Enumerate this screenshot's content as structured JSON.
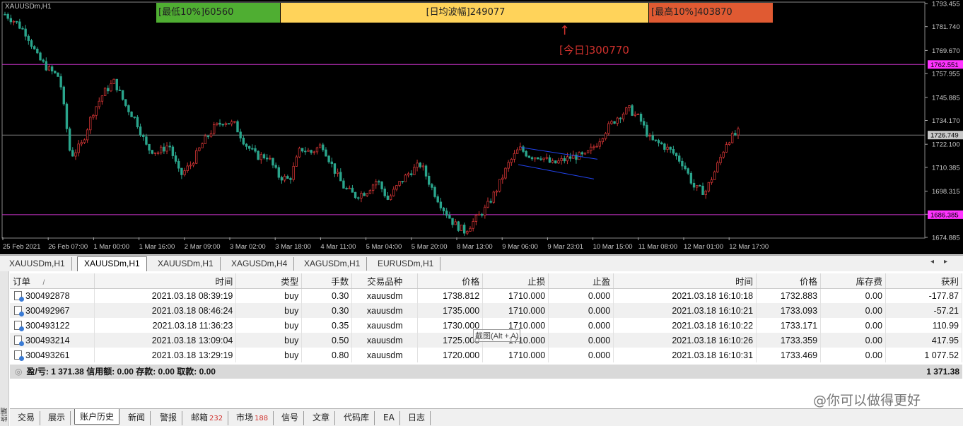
{
  "chart": {
    "title": "XAUUSDm,H1",
    "ranges": {
      "low": {
        "text": "[最低10%]60560",
        "color": "#4fae32"
      },
      "avg": {
        "text": "[日均波幅]249077",
        "color": "#ffd35a"
      },
      "high": {
        "text": "[最高10%]403870",
        "color": "#e05a32"
      }
    },
    "today_arrow": "↑",
    "today_text": "[今日]300770",
    "price_axis_labels": [
      "1793.455",
      "1781.740",
      "1769.670",
      "1757.955",
      "1745.885",
      "1734.170",
      "1722.100",
      "1710.385",
      "1698.315",
      "1686.600",
      "1674.885"
    ],
    "markers": [
      {
        "label": "1762.551",
        "value": 1762.551,
        "color": "#cc33cc"
      },
      {
        "label": "1726.749",
        "value": 1726.749,
        "color": "#7a7a7a"
      },
      {
        "label": "1686.385",
        "value": 1686.385,
        "color": "#cc33cc"
      }
    ],
    "time_labels": [
      "25 Feb 2021",
      "26 Feb 07:00",
      "1 Mar 00:00",
      "1 Mar 16:00",
      "2 Mar 09:00",
      "3 Mar 02:00",
      "3 Mar 18:00",
      "4 Mar 11:00",
      "5 Mar 04:00",
      "5 Mar 20:00",
      "8 Mar 13:00",
      "9 Mar 06:00",
      "9 Mar 23:01",
      "10 Mar 15:00",
      "11 Mar 08:00",
      "12 Mar 01:00",
      "12 Mar 17:00"
    ],
    "colors": {
      "bull": "#cc3333",
      "bear": "#2aa58c",
      "channel": "#2244ee"
    },
    "price_path": [
      1788,
      1784,
      1778,
      1766,
      1760,
      1756,
      1716,
      1722,
      1738,
      1748,
      1754,
      1742,
      1734,
      1720,
      1718,
      1722,
      1706,
      1712,
      1722,
      1730,
      1734,
      1732,
      1722,
      1716,
      1716,
      1706,
      1704,
      1720,
      1718,
      1722,
      1710,
      1700,
      1696,
      1698,
      1704,
      1694,
      1702,
      1708,
      1712,
      1700,
      1690,
      1682,
      1678,
      1684,
      1690,
      1700,
      1712,
      1720,
      1716,
      1716,
      1712,
      1714,
      1716,
      1716,
      1722,
      1730,
      1736,
      1740,
      1735,
      1724,
      1722,
      1718,
      1712,
      1700,
      1698,
      1710,
      1724,
      1728
    ]
  },
  "chart_tabs": [
    "XAUUSDm,H1",
    "XAUUSDm,H1",
    "XAUUSDm,H1",
    "XAGUSDm,H4",
    "XAGUSDm,H1",
    "EURUSDm,H1"
  ],
  "chart_tabs_active": 1,
  "table": {
    "headers": [
      "订单",
      "时间",
      "类型",
      "手数",
      "交易品种",
      "价格",
      "止损",
      "止盈",
      "时间",
      "价格",
      "库存费",
      "获利"
    ],
    "sort_marker": "/",
    "rows": [
      [
        "300492878",
        "2021.03.18 08:39:19",
        "buy",
        "0.30",
        "xauusdm",
        "1738.812",
        "1710.000",
        "0.000",
        "2021.03.18 16:10:18",
        "1732.883",
        "0.00",
        "-177.87"
      ],
      [
        "300492967",
        "2021.03.18 08:46:24",
        "buy",
        "0.30",
        "xauusdm",
        "1735.000",
        "1710.000",
        "0.000",
        "2021.03.18 16:10:21",
        "1733.093",
        "0.00",
        "-57.21"
      ],
      [
        "300493122",
        "2021.03.18 11:36:23",
        "buy",
        "0.35",
        "xauusdm",
        "1730.000",
        "1710.000",
        "0.000",
        "2021.03.18 16:10:22",
        "1733.171",
        "0.00",
        "110.99"
      ],
      [
        "300493214",
        "2021.03.18 13:09:04",
        "buy",
        "0.50",
        "xauusdm",
        "1725.000",
        "1710.000",
        "0.000",
        "2021.03.18 16:10:26",
        "1733.359",
        "0.00",
        "417.95"
      ],
      [
        "300493261",
        "2021.03.18 13:29:19",
        "buy",
        "0.80",
        "xauusdm",
        "1720.000",
        "1710.000",
        "0.000",
        "2021.03.18 16:10:31",
        "1733.469",
        "0.00",
        "1 077.52"
      ]
    ],
    "summary": "盈/亏: 1 371.38  信用额: 0.00  存款: 0.00  取款: 0.00",
    "summary_total": "1 371.38"
  },
  "tooltip": "截图(Alt + A)",
  "side_label": "终端",
  "watermark": "@你可以做得更好",
  "bottom_tabs": [
    {
      "label": "交易"
    },
    {
      "label": "展示"
    },
    {
      "label": "账户历史"
    },
    {
      "label": "新闻"
    },
    {
      "label": "警报"
    },
    {
      "label": "邮箱",
      "count": "232"
    },
    {
      "label": "市场",
      "count": "188"
    },
    {
      "label": "信号"
    },
    {
      "label": "文章"
    },
    {
      "label": "代码库"
    },
    {
      "label": "EA"
    },
    {
      "label": "日志"
    }
  ],
  "bottom_tabs_active": 2
}
